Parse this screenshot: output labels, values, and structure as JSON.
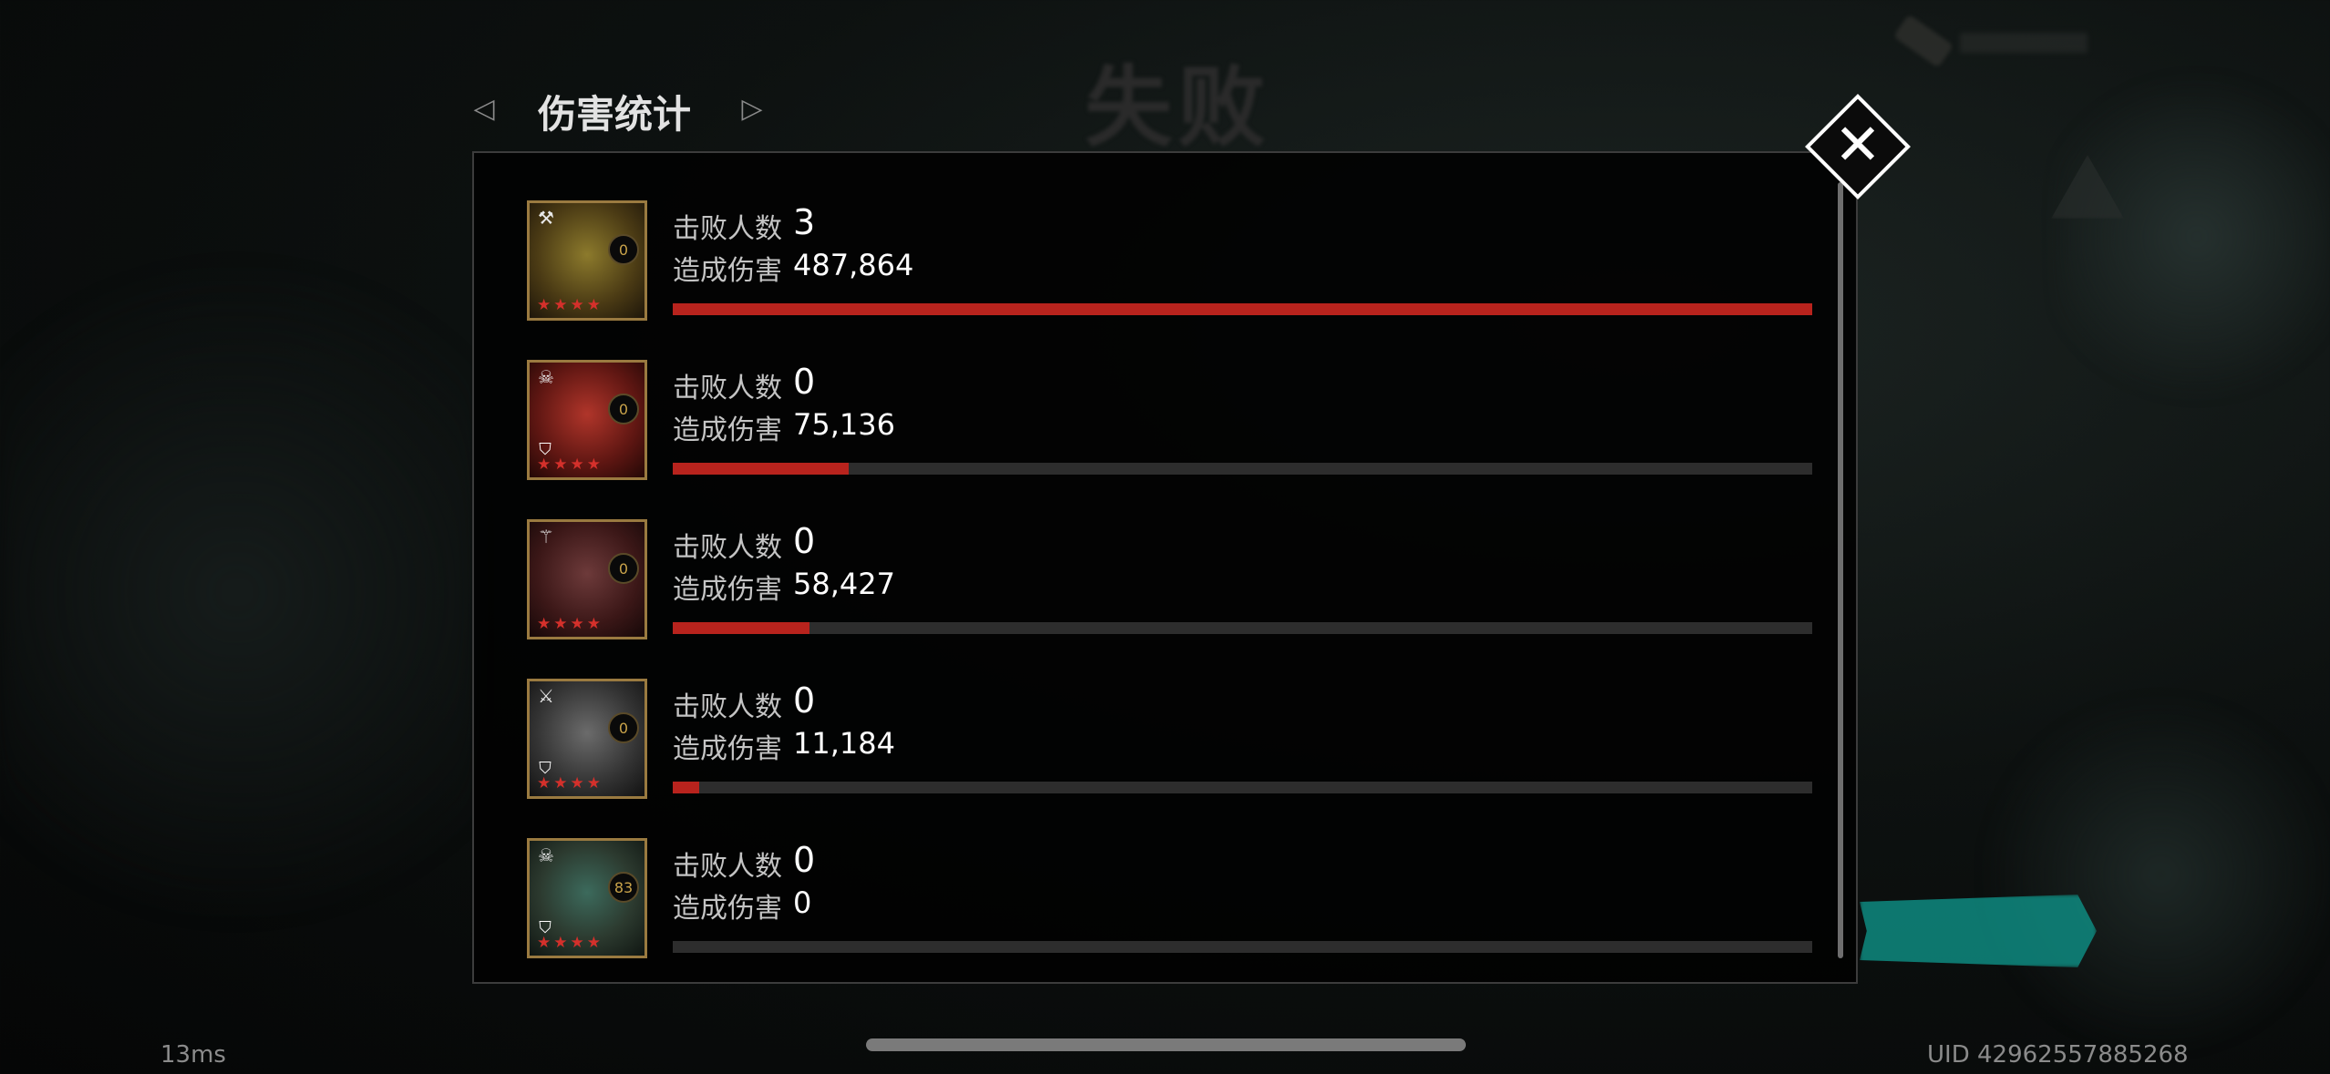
{
  "background": {
    "result_title": "失败"
  },
  "header": {
    "title": "伤害统计",
    "prev_icon": "triangle-left-icon",
    "next_icon": "triangle-right-icon"
  },
  "close_icon": "close-icon",
  "labels": {
    "defeated": "击败人数",
    "damage": "造成伤害"
  },
  "units": [
    {
      "defeated": "3",
      "damage": "487,864",
      "level": "0",
      "class_icon": "axe-icon",
      "has_shield": false,
      "stars": "★★★★",
      "damage_fraction": 1.0,
      "tint": "gold"
    },
    {
      "defeated": "0",
      "damage": "75,136",
      "level": "0",
      "class_icon": "skull-icon",
      "has_shield": true,
      "stars": "★★★★",
      "damage_fraction": 0.154,
      "tint": "red"
    },
    {
      "defeated": "0",
      "damage": "58,427",
      "level": "0",
      "class_icon": "staff-icon",
      "has_shield": false,
      "stars": "★★★★",
      "damage_fraction": 0.12,
      "tint": "crimson"
    },
    {
      "defeated": "0",
      "damage": "11,184",
      "level": "0",
      "class_icon": "sword-icon",
      "has_shield": true,
      "stars": "★★★★",
      "damage_fraction": 0.023,
      "tint": "steel"
    },
    {
      "defeated": "0",
      "damage": "0",
      "level": "83",
      "class_icon": "skull-icon",
      "has_shield": true,
      "stars": "★★★★",
      "damage_fraction": 0.0,
      "tint": "teal"
    }
  ],
  "colors": {
    "bar_fill": "#b8231d",
    "bar_track": "#2d2d2d",
    "frame_gold": "#9a7a40",
    "star_red": "#d4302b"
  },
  "footer": {
    "ping": "13ms",
    "uid": "UID 42962557885268"
  }
}
